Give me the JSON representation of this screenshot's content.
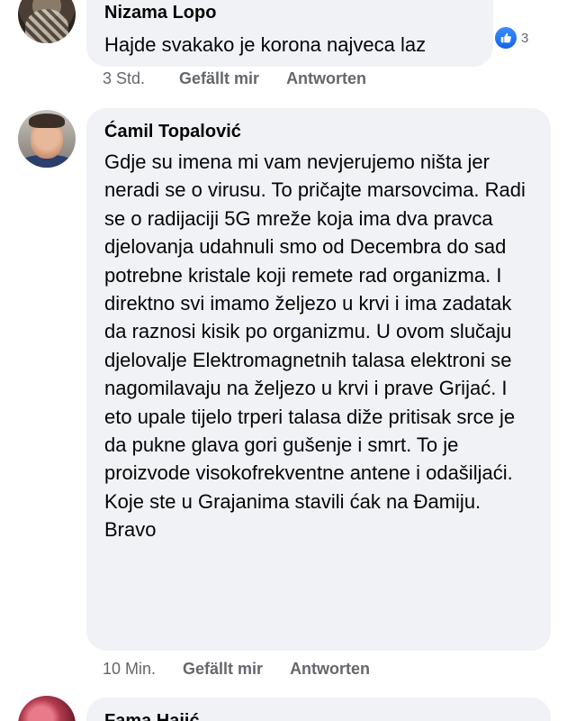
{
  "comments": [
    {
      "author": "Nizama Lopo",
      "text": "Hajde svakako je korona najveca laz",
      "reaction_count": "3",
      "time": "3 Std.",
      "like_label": "Gefällt mir",
      "reply_label": "Antworten"
    },
    {
      "author": "Ćamil Topalović",
      "text": "Gdje su imena mi vam nevjerujemo ništa jer neradi se o virusu. To pričajte marsovcima. Radi se o radijaciji 5G mreže koja ima dva pravca djelovanja udahnuli smo od Decembra do sad potrebne kristale koji remete rad organizma. I direktno svi imamo željezo u krvi i ima zadatak da raznosi kisik po organizmu. U ovom slučaju djelovalje Elektromagnetnih talasa elektroni se nagomilavaju na željezo u krvi i prave Grijać. I eto upale tijelo trperi talasa diže pritisak srce je da pukne glava gori gušenje i smrt. To je proizvode visokofrekventne antene i odašiljaći. Koje ste u Grajanima stavili ćak na Đamiju. Bravo",
      "time": "10 Min.",
      "like_label": "Gefällt mir",
      "reply_label": "Antworten"
    },
    {
      "author": "Fama Hajić"
    }
  ],
  "colors": {
    "bubble": "#f0f2f5",
    "meta_text": "#65676b",
    "like_blue": "#1877f2"
  },
  "icons": {
    "reaction": "like-thumbs-up-icon"
  }
}
